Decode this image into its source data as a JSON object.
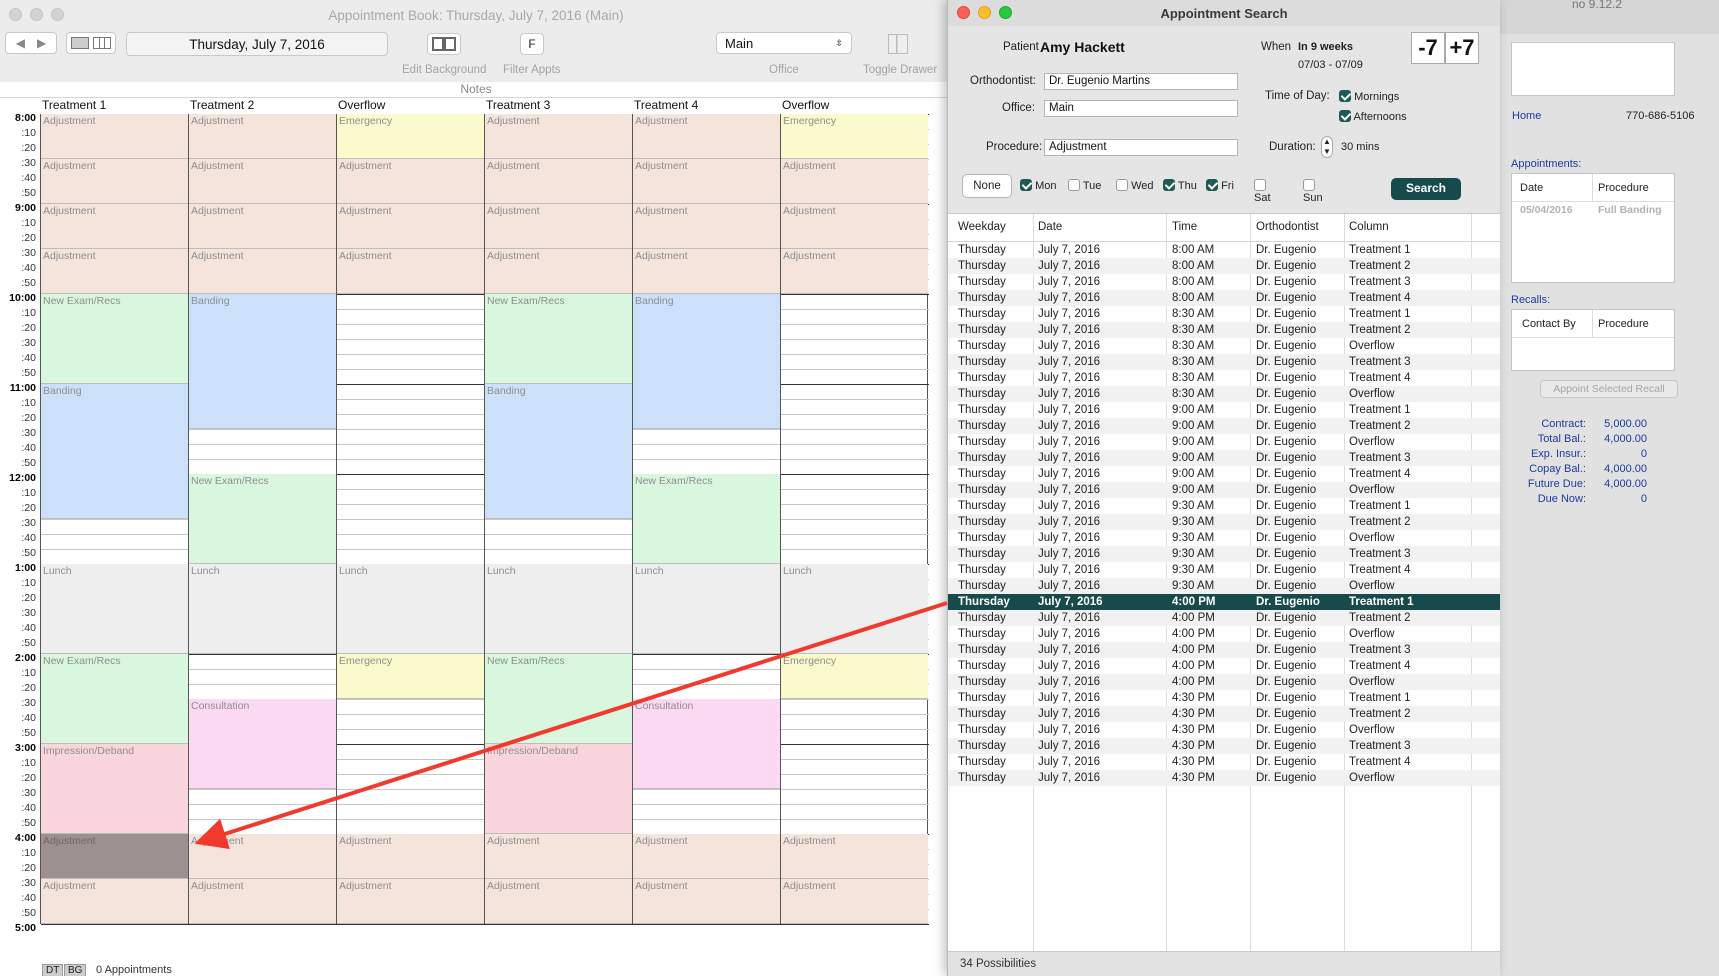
{
  "book": {
    "title": "Appointment Book: Thursday, July 7, 2016 (Main)",
    "date": "Thursday, July 7, 2016",
    "filter_btn": "F",
    "office_select": "Main",
    "labels": {
      "edit_background": "Edit Background",
      "filter_appts": "Filter Appts",
      "office": "Office",
      "toggle_drawer": "Toggle Drawer",
      "notes": "Notes"
    },
    "columns": [
      "Treatment 1",
      "Treatment 2",
      "Overflow",
      "Treatment 3",
      "Treatment 4",
      "Overflow"
    ],
    "times": [
      "8:00",
      ":10",
      ":20",
      ":30",
      ":40",
      ":50",
      "9:00",
      ":10",
      ":20",
      ":30",
      ":40",
      ":50",
      "10:00",
      ":10",
      ":20",
      ":30",
      ":40",
      ":50",
      "11:00",
      ":10",
      ":20",
      ":30",
      ":40",
      ":50",
      "12:00",
      ":10",
      ":20",
      ":30",
      ":40",
      ":50",
      "1:00",
      ":10",
      ":20",
      ":30",
      ":40",
      ":50",
      "2:00",
      ":10",
      ":20",
      ":30",
      ":40",
      ":50",
      "3:00",
      ":10",
      ":20",
      ":30",
      ":40",
      ":50",
      "4:00",
      ":10",
      ":20",
      ":30",
      ":40",
      ":50",
      "5:00"
    ],
    "appointments": [
      [
        {
          "label": "Adjustment",
          "start": 0,
          "slots": 3,
          "color": "#f5e4dc"
        },
        {
          "label": "Adjustment",
          "start": 3,
          "slots": 3,
          "color": "#f5e4dc"
        },
        {
          "label": "Adjustment",
          "start": 6,
          "slots": 3,
          "color": "#f5e4dc"
        },
        {
          "label": "Adjustment",
          "start": 9,
          "slots": 3,
          "color": "#f5e4dc"
        },
        {
          "label": "New Exam/Recs",
          "start": 12,
          "slots": 6,
          "color": "#d9f7df"
        },
        {
          "label": "Banding",
          "start": 18,
          "slots": 9,
          "color": "#cde0fa"
        },
        {
          "label": "Lunch",
          "start": 30,
          "slots": 6,
          "color": "#eeeeee"
        },
        {
          "label": "New Exam/Recs",
          "start": 36,
          "slots": 6,
          "color": "#d9f7df"
        },
        {
          "label": "Impression/Deband",
          "start": 42,
          "slots": 6,
          "color": "#fbd5dd"
        },
        {
          "label": "Adjustment",
          "start": 48,
          "slots": 3,
          "color": "#9c918e"
        },
        {
          "label": "Adjustment",
          "start": 51,
          "slots": 3,
          "color": "#f5e4dc"
        }
      ],
      [
        {
          "label": "Adjustment",
          "start": 0,
          "slots": 3,
          "color": "#f5e4dc"
        },
        {
          "label": "Adjustment",
          "start": 3,
          "slots": 3,
          "color": "#f5e4dc"
        },
        {
          "label": "Adjustment",
          "start": 6,
          "slots": 3,
          "color": "#f5e4dc"
        },
        {
          "label": "Adjustment",
          "start": 9,
          "slots": 3,
          "color": "#f5e4dc"
        },
        {
          "label": "Banding",
          "start": 12,
          "slots": 9,
          "color": "#cde0fa"
        },
        {
          "label": "New Exam/Recs",
          "start": 24,
          "slots": 6,
          "color": "#d9f7df"
        },
        {
          "label": "Lunch",
          "start": 30,
          "slots": 6,
          "color": "#eeeeee"
        },
        {
          "label": "Consultation",
          "start": 39,
          "slots": 6,
          "color": "#fbd9f3"
        },
        {
          "label": "Adjustment",
          "start": 48,
          "slots": 3,
          "color": "#f5e4dc"
        },
        {
          "label": "Adjustment",
          "start": 51,
          "slots": 3,
          "color": "#f5e4dc"
        }
      ],
      [
        {
          "label": "Emergency",
          "start": 0,
          "slots": 3,
          "color": "#fafacc"
        },
        {
          "label": "Adjustment",
          "start": 3,
          "slots": 3,
          "color": "#f5e4dc"
        },
        {
          "label": "Adjustment",
          "start": 6,
          "slots": 3,
          "color": "#f5e4dc"
        },
        {
          "label": "Adjustment",
          "start": 9,
          "slots": 3,
          "color": "#f5e4dc"
        },
        {
          "label": "Lunch",
          "start": 30,
          "slots": 6,
          "color": "#eeeeee"
        },
        {
          "label": "Emergency",
          "start": 36,
          "slots": 3,
          "color": "#fafacc"
        },
        {
          "label": "Adjustment",
          "start": 48,
          "slots": 3,
          "color": "#f5e4dc"
        },
        {
          "label": "Adjustment",
          "start": 51,
          "slots": 3,
          "color": "#f5e4dc"
        }
      ],
      [
        {
          "label": "Adjustment",
          "start": 0,
          "slots": 3,
          "color": "#f5e4dc"
        },
        {
          "label": "Adjustment",
          "start": 3,
          "slots": 3,
          "color": "#f5e4dc"
        },
        {
          "label": "Adjustment",
          "start": 6,
          "slots": 3,
          "color": "#f5e4dc"
        },
        {
          "label": "Adjustment",
          "start": 9,
          "slots": 3,
          "color": "#f5e4dc"
        },
        {
          "label": "New Exam/Recs",
          "start": 12,
          "slots": 6,
          "color": "#d9f7df"
        },
        {
          "label": "Banding",
          "start": 18,
          "slots": 9,
          "color": "#cde0fa"
        },
        {
          "label": "Lunch",
          "start": 30,
          "slots": 6,
          "color": "#eeeeee"
        },
        {
          "label": "New Exam/Recs",
          "start": 36,
          "slots": 6,
          "color": "#d9f7df"
        },
        {
          "label": "Impression/Deband",
          "start": 42,
          "slots": 6,
          "color": "#fbd5dd"
        },
        {
          "label": "Adjustment",
          "start": 48,
          "slots": 3,
          "color": "#f5e4dc"
        },
        {
          "label": "Adjustment",
          "start": 51,
          "slots": 3,
          "color": "#f5e4dc"
        }
      ],
      [
        {
          "label": "Adjustment",
          "start": 0,
          "slots": 3,
          "color": "#f5e4dc"
        },
        {
          "label": "Adjustment",
          "start": 3,
          "slots": 3,
          "color": "#f5e4dc"
        },
        {
          "label": "Adjustment",
          "start": 6,
          "slots": 3,
          "color": "#f5e4dc"
        },
        {
          "label": "Adjustment",
          "start": 9,
          "slots": 3,
          "color": "#f5e4dc"
        },
        {
          "label": "Banding",
          "start": 12,
          "slots": 9,
          "color": "#cde0fa"
        },
        {
          "label": "New Exam/Recs",
          "start": 24,
          "slots": 6,
          "color": "#d9f7df"
        },
        {
          "label": "Lunch",
          "start": 30,
          "slots": 6,
          "color": "#eeeeee"
        },
        {
          "label": "Consultation",
          "start": 39,
          "slots": 6,
          "color": "#fbd9f3"
        },
        {
          "label": "Adjustment",
          "start": 48,
          "slots": 3,
          "color": "#f5e4dc"
        },
        {
          "label": "Adjustment",
          "start": 51,
          "slots": 3,
          "color": "#f5e4dc"
        }
      ],
      [
        {
          "label": "Emergency",
          "start": 0,
          "slots": 3,
          "color": "#fafacc"
        },
        {
          "label": "Adjustment",
          "start": 3,
          "slots": 3,
          "color": "#f5e4dc"
        },
        {
          "label": "Adjustment",
          "start": 6,
          "slots": 3,
          "color": "#f5e4dc"
        },
        {
          "label": "Adjustment",
          "start": 9,
          "slots": 3,
          "color": "#f5e4dc"
        },
        {
          "label": "Lunch",
          "start": 30,
          "slots": 6,
          "color": "#eeeeee"
        },
        {
          "label": "Emergency",
          "start": 36,
          "slots": 3,
          "color": "#fafacc"
        },
        {
          "label": "Adjustment",
          "start": 48,
          "slots": 3,
          "color": "#f5e4dc"
        },
        {
          "label": "Adjustment",
          "start": 51,
          "slots": 3,
          "color": "#f5e4dc"
        }
      ]
    ],
    "bottom_tabs": [
      "DT",
      "BG"
    ],
    "appointments_count": "0 Appointments"
  },
  "search": {
    "title": "Appointment Search",
    "patient_label": "Patient",
    "patient_name": "Amy Hackett",
    "when_label": "When",
    "when_value": "In 9 weeks",
    "when_range": "07/03 - 07/09",
    "minus_btn": "-7",
    "plus_btn": "+7",
    "orthodontist_label": "Orthodontist:",
    "orthodontist_value": "Dr. Eugenio Martins",
    "office_label": "Office:",
    "office_value": "Main",
    "procedure_label": "Procedure:",
    "procedure_value": "Adjustment",
    "time_of_day_label": "Time of Day:",
    "mornings_label": "Mornings",
    "afternoons_label": "Afternoons",
    "duration_label": "Duration:",
    "duration_value": "30 mins",
    "none_btn": "None",
    "days": [
      {
        "label": "Mon",
        "checked": true
      },
      {
        "label": "Tue",
        "checked": false
      },
      {
        "label": "Wed",
        "checked": false
      },
      {
        "label": "Thu",
        "checked": true
      },
      {
        "label": "Fri",
        "checked": true
      },
      {
        "label": "Sat",
        "checked": false
      },
      {
        "label": "Sun",
        "checked": false
      }
    ],
    "search_btn": "Search",
    "table_headers": [
      "Weekday",
      "Date",
      "Time",
      "Orthodontist",
      "Column"
    ],
    "rows": [
      [
        "Thursday",
        "July 7, 2016",
        "8:00 AM",
        "Dr. Eugenio",
        "Treatment 1"
      ],
      [
        "Thursday",
        "July 7, 2016",
        "8:00 AM",
        "Dr. Eugenio",
        "Treatment 2"
      ],
      [
        "Thursday",
        "July 7, 2016",
        "8:00 AM",
        "Dr. Eugenio",
        "Treatment 3"
      ],
      [
        "Thursday",
        "July 7, 2016",
        "8:00 AM",
        "Dr. Eugenio",
        "Treatment 4"
      ],
      [
        "Thursday",
        "July 7, 2016",
        "8:30 AM",
        "Dr. Eugenio",
        "Treatment 1"
      ],
      [
        "Thursday",
        "July 7, 2016",
        "8:30 AM",
        "Dr. Eugenio",
        "Treatment 2"
      ],
      [
        "Thursday",
        "July 7, 2016",
        "8:30 AM",
        "Dr. Eugenio",
        "Overflow"
      ],
      [
        "Thursday",
        "July 7, 2016",
        "8:30 AM",
        "Dr. Eugenio",
        "Treatment 3"
      ],
      [
        "Thursday",
        "July 7, 2016",
        "8:30 AM",
        "Dr. Eugenio",
        "Treatment 4"
      ],
      [
        "Thursday",
        "July 7, 2016",
        "8:30 AM",
        "Dr. Eugenio",
        "Overflow"
      ],
      [
        "Thursday",
        "July 7, 2016",
        "9:00 AM",
        "Dr. Eugenio",
        "Treatment 1"
      ],
      [
        "Thursday",
        "July 7, 2016",
        "9:00 AM",
        "Dr. Eugenio",
        "Treatment 2"
      ],
      [
        "Thursday",
        "July 7, 2016",
        "9:00 AM",
        "Dr. Eugenio",
        "Overflow"
      ],
      [
        "Thursday",
        "July 7, 2016",
        "9:00 AM",
        "Dr. Eugenio",
        "Treatment 3"
      ],
      [
        "Thursday",
        "July 7, 2016",
        "9:00 AM",
        "Dr. Eugenio",
        "Treatment 4"
      ],
      [
        "Thursday",
        "July 7, 2016",
        "9:00 AM",
        "Dr. Eugenio",
        "Overflow"
      ],
      [
        "Thursday",
        "July 7, 2016",
        "9:30 AM",
        "Dr. Eugenio",
        "Treatment 1"
      ],
      [
        "Thursday",
        "July 7, 2016",
        "9:30 AM",
        "Dr. Eugenio",
        "Treatment 2"
      ],
      [
        "Thursday",
        "July 7, 2016",
        "9:30 AM",
        "Dr. Eugenio",
        "Overflow"
      ],
      [
        "Thursday",
        "July 7, 2016",
        "9:30 AM",
        "Dr. Eugenio",
        "Treatment 3"
      ],
      [
        "Thursday",
        "July 7, 2016",
        "9:30 AM",
        "Dr. Eugenio",
        "Treatment 4"
      ],
      [
        "Thursday",
        "July 7, 2016",
        "9:30 AM",
        "Dr. Eugenio",
        "Overflow"
      ],
      [
        "Thursday",
        "July 7, 2016",
        "4:00 PM",
        "Dr. Eugenio",
        "Treatment 1"
      ],
      [
        "Thursday",
        "July 7, 2016",
        "4:00 PM",
        "Dr. Eugenio",
        "Treatment 2"
      ],
      [
        "Thursday",
        "July 7, 2016",
        "4:00 PM",
        "Dr. Eugenio",
        "Overflow"
      ],
      [
        "Thursday",
        "July 7, 2016",
        "4:00 PM",
        "Dr. Eugenio",
        "Treatment 3"
      ],
      [
        "Thursday",
        "July 7, 2016",
        "4:00 PM",
        "Dr. Eugenio",
        "Treatment 4"
      ],
      [
        "Thursday",
        "July 7, 2016",
        "4:00 PM",
        "Dr. Eugenio",
        "Overflow"
      ],
      [
        "Thursday",
        "July 7, 2016",
        "4:30 PM",
        "Dr. Eugenio",
        "Treatment 1"
      ],
      [
        "Thursday",
        "July 7, 2016",
        "4:30 PM",
        "Dr. Eugenio",
        "Treatment 2"
      ],
      [
        "Thursday",
        "July 7, 2016",
        "4:30 PM",
        "Dr. Eugenio",
        "Overflow"
      ],
      [
        "Thursday",
        "July 7, 2016",
        "4:30 PM",
        "Dr. Eugenio",
        "Treatment 3"
      ],
      [
        "Thursday",
        "July 7, 2016",
        "4:30 PM",
        "Dr. Eugenio",
        "Treatment 4"
      ],
      [
        "Thursday",
        "July 7, 2016",
        "4:30 PM",
        "Dr. Eugenio",
        "Overflow"
      ]
    ],
    "selected_row": 22,
    "status": "34 Possibilities"
  },
  "drawer": {
    "top_text": "no 9.12.2",
    "home_label": "Home",
    "home_phone": "770-686-5106",
    "appointments_label": "Appointments:",
    "appt_headers": [
      "Date",
      "Procedure"
    ],
    "appt_rows": [
      [
        "05/04/2016",
        "Full Banding"
      ]
    ],
    "recalls_label": "Recalls:",
    "recall_headers": [
      "Contact By",
      "Procedure"
    ],
    "appoint_recall_btn": "Appoint Selected Recall",
    "balances": [
      {
        "label": "Contract:",
        "value": "5,000.00"
      },
      {
        "label": "Total Bal.:",
        "value": "4,000.00"
      },
      {
        "label": "Exp. Insur.:",
        "value": "0"
      },
      {
        "label": "Copay Bal.:",
        "value": "4,000.00"
      },
      {
        "label": "Future Due:",
        "value": "4,000.00"
      },
      {
        "label": "Due Now:",
        "value": "0"
      }
    ]
  },
  "colors": {
    "accent": "#174b4b",
    "annotation_arrow": "#f03a2e"
  }
}
